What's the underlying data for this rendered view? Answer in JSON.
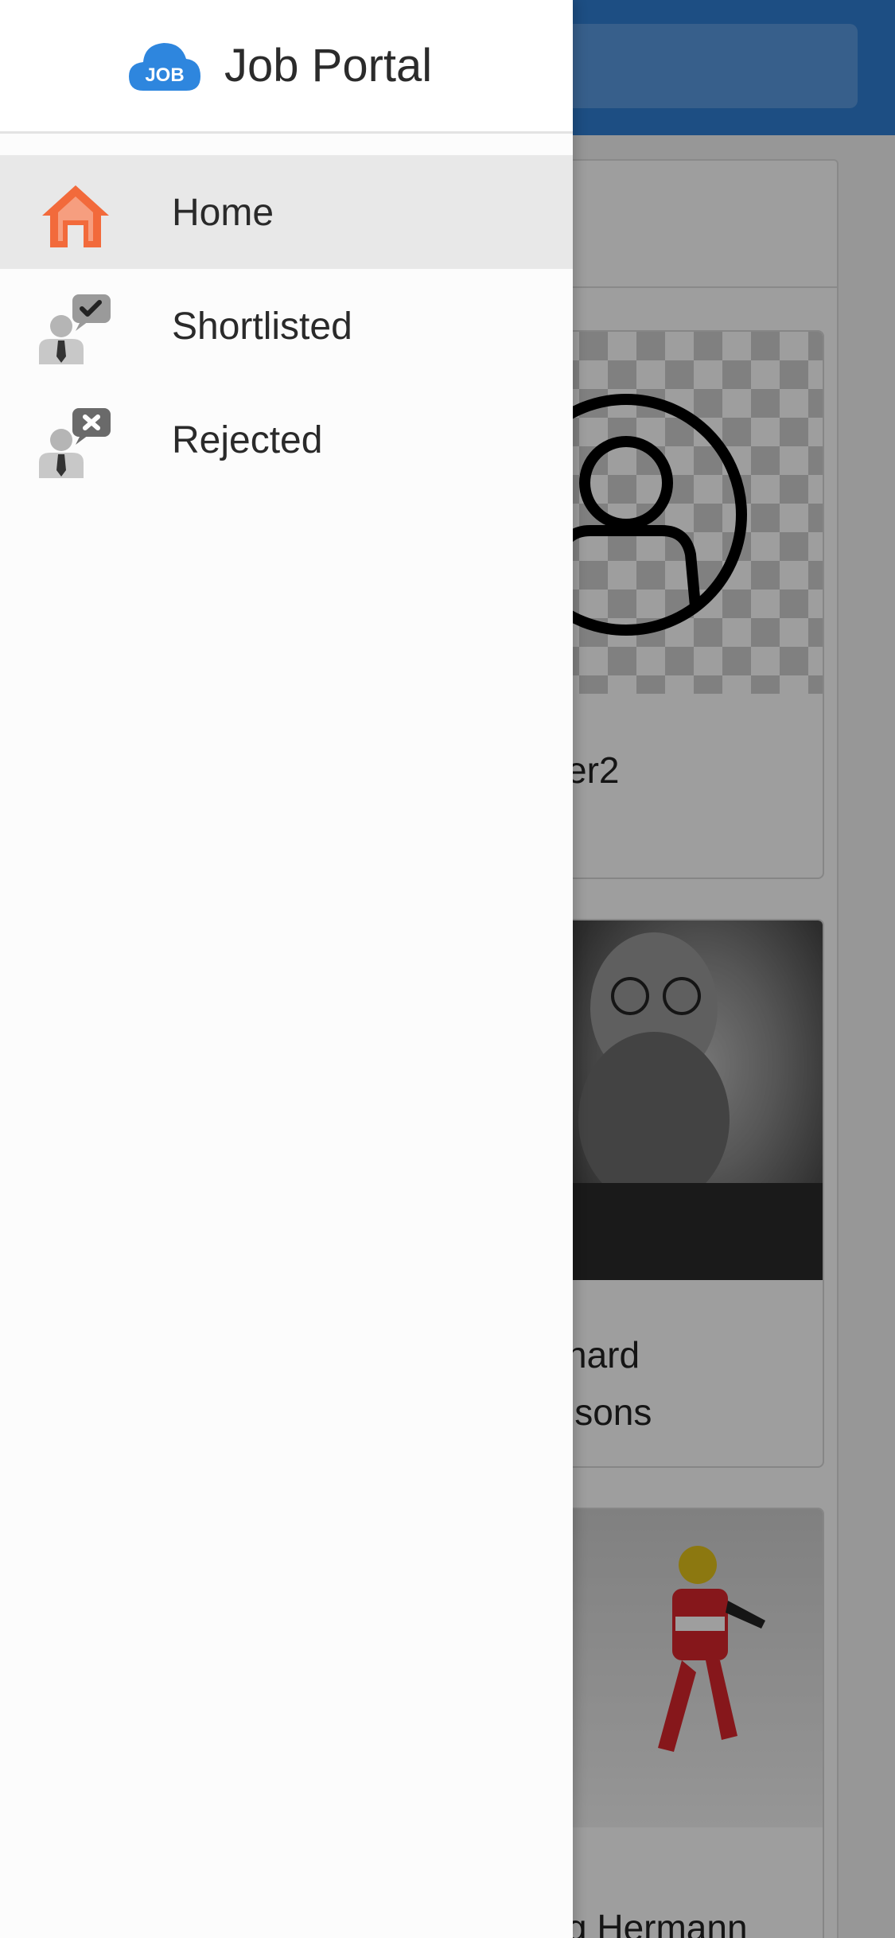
{
  "drawer": {
    "title": "Job Portal",
    "logo_text": "JOB",
    "logo_icon": "job-cloud-icon",
    "items": [
      {
        "label": "Home",
        "icon": "home-icon",
        "active": true
      },
      {
        "label": "Shortlisted",
        "icon": "shortlisted-icon",
        "active": false
      },
      {
        "label": "Rejected",
        "icon": "rejected-icon",
        "active": false
      }
    ]
  },
  "background": {
    "cards": [
      {
        "name": "er2"
      },
      {
        "name": "nard\nisons"
      },
      {
        "name": "g Hermann"
      }
    ]
  },
  "colors": {
    "header": "#2f7fd4",
    "home_icon": "#f26a3b",
    "logo": "#2e86de",
    "active_item_bg": "#e8e8e8"
  }
}
